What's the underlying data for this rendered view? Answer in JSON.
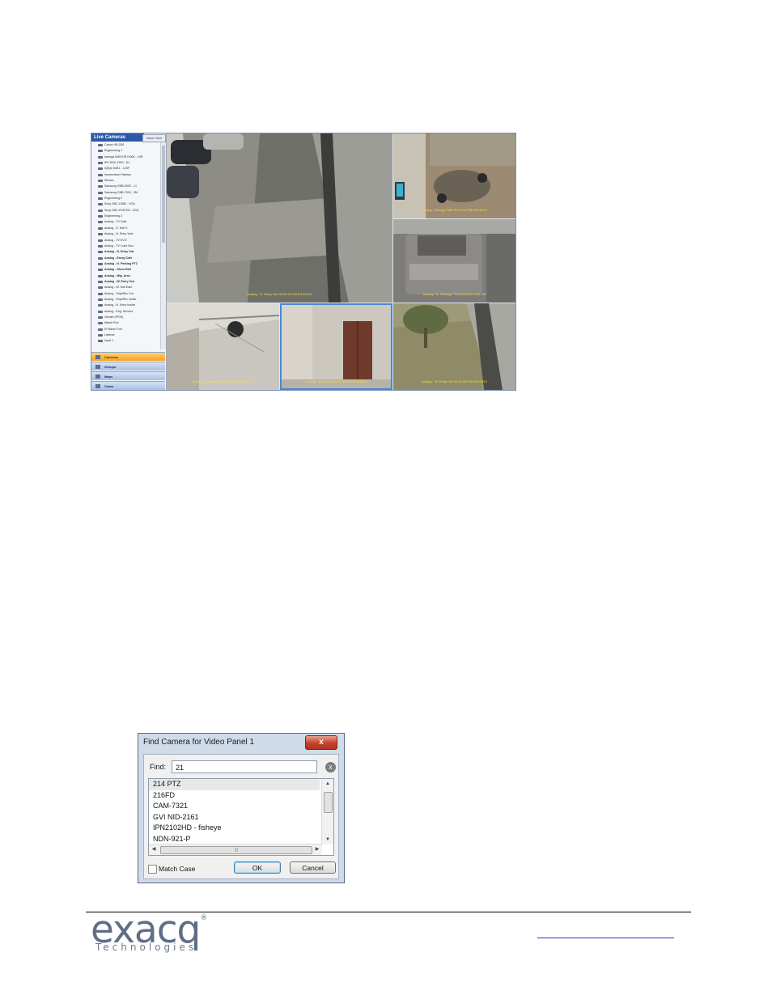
{
  "live_cameras": {
    "title": "Live Cameras",
    "tab": "Save View",
    "tree": [
      {
        "label": "Canon VB-C60",
        "bold": false
      },
      {
        "label": "Engineering 1",
        "bold": false
      },
      {
        "label": "Iomega INDOOR HD64 - 10R",
        "bold": false
      },
      {
        "label": "IPX DDK-1500 - D1",
        "bold": false
      },
      {
        "label": "IQEye 62B1 - 14SF",
        "bold": false
      },
      {
        "label": "Immervision Fisheye",
        "bold": false
      },
      {
        "label": "Stream",
        "bold": false
      },
      {
        "label": "Samsung SNB-5000 - L1",
        "bold": false
      },
      {
        "label": "Samsung SNB-7000 - 3M",
        "bold": false
      },
      {
        "label": "Engineering 2",
        "bold": false
      },
      {
        "label": "Sony SNC-DS80 - VGA",
        "bold": false
      },
      {
        "label": "Sony SNC-RX570N - VGA",
        "bold": false
      },
      {
        "label": "Engineering 3",
        "bold": false
      },
      {
        "label": "Analog - TV Cafe",
        "bold": false
      },
      {
        "label": "Analog - S. Hall S.",
        "bold": false
      },
      {
        "label": "Analog - N. Entry Vest",
        "bold": false
      },
      {
        "label": "Analog - TV EVO",
        "bold": false
      },
      {
        "label": "Analog - TV Color Box",
        "bold": false
      },
      {
        "label": "Analog - N. Entry Out",
        "bold": true
      },
      {
        "label": "Analog - Energ Cafe",
        "bold": true
      },
      {
        "label": "Analog - N. Parking PTZ",
        "bold": true
      },
      {
        "label": "Analog - Disco Ball",
        "bold": true
      },
      {
        "label": "Analog - Mfg. Area",
        "bold": true
      },
      {
        "label": "Analog - W. Entry Out",
        "bold": true
      },
      {
        "label": "Analog - W. Hall East",
        "bold": false
      },
      {
        "label": "Analog - Ship/Rec Out",
        "bold": false
      },
      {
        "label": "Analog - Ship/Rec Inside",
        "bold": false
      },
      {
        "label": "Analog - N. Entry Inside",
        "bold": false
      },
      {
        "label": "Analog - Eng. Servers",
        "bold": false
      },
      {
        "label": "Viewlet (PRIV)",
        "bold": false
      },
      {
        "label": "Marsh Port",
        "bold": false
      },
      {
        "label": "IP Marsh Port",
        "bold": false
      },
      {
        "label": "Listener",
        "bold": false
      },
      {
        "label": "Input 1",
        "bold": false
      }
    ],
    "nav": [
      {
        "label": "Cameras",
        "active": true
      },
      {
        "label": "Groups",
        "active": false
      },
      {
        "label": "Maps",
        "active": false
      },
      {
        "label": "Views",
        "active": false
      }
    ],
    "panels": [
      {
        "label": "Analog - N. Entry Out 02:02:44 PM 6/11/2012"
      },
      {
        "label": "Analog - Energy Cafe 02:02:44 PM 6/11/2012"
      },
      {
        "label": "Analog - N. Parking PTZ 6/11/2012 2:44 PM"
      },
      {
        "label": "Analog - Disco Ball 02:02:44 PM 6/11/2012"
      },
      {
        "label": "Analog - Mfg. Area 02:02:44 PM 6/11/2012"
      },
      {
        "label": "Analog - W. Entry Out 02:02:44 PM 6/11/2012"
      }
    ]
  },
  "find_dialog": {
    "title": "Find Camera for Video Panel 1",
    "close_label": "x",
    "find_label": "Find:",
    "find_value": "21",
    "clear_icon": "x",
    "results": [
      "214 PTZ",
      "216FD",
      "CAM-7321",
      "GVI NID-2161",
      "IPN2102HD - fisheye",
      "NDN-921-P"
    ],
    "selected_index": 0,
    "match_case_label": "Match Case",
    "ok_label": "OK",
    "cancel_label": "Cancel"
  },
  "footer": {
    "logo_word": "exacq",
    "logo_mark": "®",
    "logo_sub": "Technologies"
  }
}
